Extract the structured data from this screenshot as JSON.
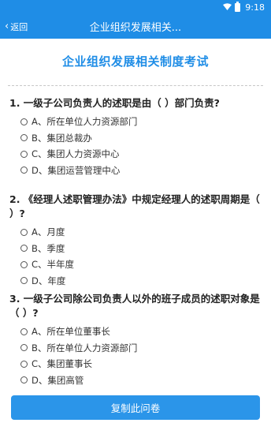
{
  "status_bar": {
    "time": "9:18"
  },
  "header": {
    "back_label": "返回",
    "title": "企业组织发展相关..."
  },
  "exam_title": "企业组织发展相关制度考试",
  "questions": [
    {
      "text": "1. 一级子公司负责人的述职是由（ ）部门负责?",
      "options": [
        "A、所在单位人力资源部门",
        "B、集团总裁办",
        "C、集团人力资源中心",
        "D、集团运营管理中心"
      ]
    },
    {
      "text": "2. 《经理人述职管理办法》中规定经理人的述职周期是（ ）?",
      "options": [
        "A、月度",
        "B、季度",
        "C、半年度",
        "D、年度"
      ]
    },
    {
      "text": "3. 一级子公司除公司负责人以外的班子成员的述职对象是（ ）?",
      "options": [
        "A、所在单位董事长",
        "B、所在单位人力资源部门",
        "C、集团董事长",
        "D、集团高管"
      ]
    }
  ],
  "copy_button": "复制此问卷"
}
